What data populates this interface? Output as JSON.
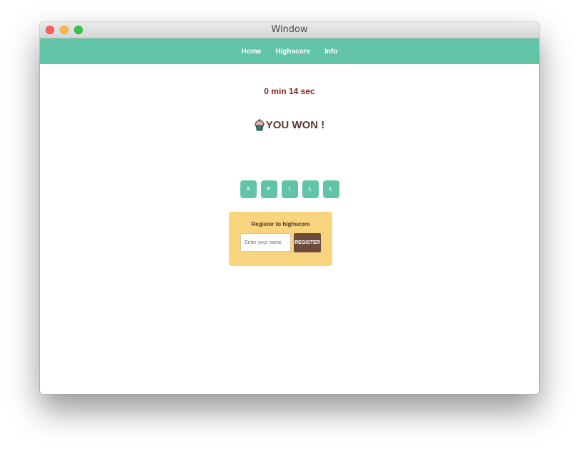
{
  "window": {
    "title": "Window"
  },
  "nav": {
    "items": [
      {
        "label": "Home"
      },
      {
        "label": "Highscore"
      },
      {
        "label": "Info"
      }
    ]
  },
  "game": {
    "timer": "0 min 14 sec",
    "result_icon": "cupcake-icon",
    "result": "YOU WON !",
    "letters": [
      "S",
      "P",
      "I",
      "L",
      "L"
    ]
  },
  "register": {
    "title": "Register to highscore",
    "input_placeholder": "Enter your name",
    "input_value": "",
    "button_label": "REGISTER"
  },
  "colors": {
    "accent": "#62c4a7",
    "timer": "#8b1a1a",
    "heading": "#5b3a2e",
    "card": "#f8d47e",
    "button": "#6d4c3d"
  }
}
